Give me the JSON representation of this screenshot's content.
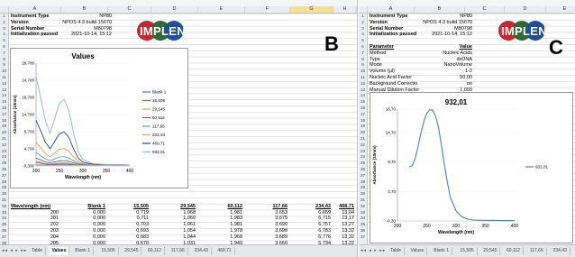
{
  "panel_b": {
    "columns": [
      "A",
      "B",
      "C",
      "D",
      "E",
      "F",
      "G",
      "H"
    ],
    "rows": [
      "1",
      "2",
      "3",
      "4",
      "5",
      "6",
      "7",
      "8",
      "9",
      "10",
      "11",
      "12",
      "13",
      "14",
      "15",
      "16",
      "17",
      "18",
      "19",
      "20",
      "21",
      "22",
      "23",
      "24",
      "25",
      "26",
      "27",
      "28",
      "29",
      "30",
      "31",
      "32",
      "33",
      "34",
      "35",
      "36",
      "37",
      "38",
      "39"
    ],
    "info": [
      {
        "label": "Instrument Type",
        "value": "NP80"
      },
      {
        "label": "Version",
        "value": "NPOS 4.3 build 15670"
      },
      {
        "label": "Serial Number",
        "value": "M80798"
      },
      {
        "label": "Initialization passed",
        "value": "2021-10-14, 15:12"
      }
    ],
    "logo": "IMPLEN",
    "panel_letter": "B",
    "table_headers": [
      "Wavelength (nm)",
      "Blank 1",
      "15,505",
      "29,545",
      "60,112",
      "117,66",
      "234,43",
      "468,71"
    ],
    "table_rows": [
      [
        "200",
        "0,000",
        "0,719",
        "1,068",
        "1,981",
        "3,653",
        "6,659",
        "13,04"
      ],
      [
        "201",
        "0,000",
        "0,711",
        "1,060",
        "1,983",
        "3,675",
        "6,715",
        "13,17"
      ],
      [
        "202",
        "0,000",
        "0,703",
        "1,061",
        "1,981",
        "3,690",
        "6,757",
        "13,27"
      ],
      [
        "203",
        "0,000",
        "0,693",
        "1,054",
        "1,978",
        "3,698",
        "6,783",
        "13,32"
      ],
      [
        "204",
        "0,000",
        "0,683",
        "1,044",
        "1,968",
        "3,689",
        "6,776",
        "13,32"
      ],
      [
        "205",
        "0,000",
        "0,670",
        "1,031",
        "1,949",
        "3,660",
        "6,734",
        "13,22"
      ]
    ],
    "tabs": [
      "Table",
      "Values",
      "Blank 1",
      "15,505",
      "29,545",
      "60,112",
      "117,66",
      "234,43",
      "468,71"
    ],
    "active_tab": "Values"
  },
  "panel_c": {
    "columns": [
      "A",
      "B",
      "C",
      "D",
      "E"
    ],
    "rows": [
      "1",
      "2",
      "3",
      "4",
      "5",
      "6",
      "7",
      "8",
      "9",
      "10",
      "11",
      "12",
      "13",
      "14",
      "15",
      "16",
      "17",
      "18",
      "19",
      "20",
      "21",
      "22",
      "23",
      "24",
      "25",
      "26",
      "27",
      "28",
      "29",
      "30",
      "31",
      "32",
      "33",
      "34",
      "35",
      "36",
      "37"
    ],
    "info": [
      {
        "label": "Instrument Type",
        "value": "NP80"
      },
      {
        "label": "Version",
        "value": "NPOS 4.3 build 15670"
      },
      {
        "label": "Serial Number",
        "value": "M80798"
      },
      {
        "label": "Initialization passed",
        "value": "2021-10-14, 15:12"
      }
    ],
    "param_header": {
      "label": "Parameter",
      "value": "Value"
    },
    "params": [
      {
        "label": "Method",
        "value": "Nucleic Acids"
      },
      {
        "label": "Type",
        "value": "dsDNA"
      },
      {
        "label": "Mode",
        "value": "NanoVolume"
      },
      {
        "label": "Volume (µl)",
        "value": "1-2"
      },
      {
        "label": "Nucleic Acid Factor",
        "value": "50,00"
      },
      {
        "label": "Background Correctio",
        "value": "on"
      },
      {
        "label": "Manual Dilution Factor",
        "value": "1,000"
      }
    ],
    "logo": "IMPLEN",
    "panel_letter": "C",
    "tabs": [
      "Table",
      "Values",
      "Blank 1",
      "15,505",
      "29,545",
      "60,112",
      "117,66",
      "234,43",
      "468,71",
      "932,01"
    ],
    "active_tab": "932,01"
  },
  "chart_data": [
    {
      "type": "line",
      "title": "Values",
      "xlabel": "Wavelength (nm)",
      "ylabel": "Absorbance (10mm)",
      "xlim": [
        200,
        400
      ],
      "ylim": [
        -0.3,
        29.7
      ],
      "xticks": [
        200,
        250,
        300,
        350,
        400
      ],
      "yticks": [
        "29,700",
        "24,700",
        "19,700",
        "14,700",
        "9,700",
        "4,700",
        "-0,300"
      ],
      "legend_position": "right",
      "x": [
        200,
        210,
        220,
        230,
        240,
        250,
        260,
        270,
        280,
        290,
        300,
        320,
        350,
        400
      ],
      "series": [
        {
          "name": "Blank 1",
          "color": "#4a77b4",
          "values": [
            0,
            0,
            0,
            0,
            0,
            0,
            0,
            0,
            0,
            0,
            0,
            0,
            0,
            0
          ]
        },
        {
          "name": "15,505",
          "color": "#c0504d",
          "values": [
            0.72,
            0.5,
            0.28,
            0.16,
            0.22,
            0.29,
            0.31,
            0.26,
            0.15,
            0.06,
            0.03,
            0.01,
            0,
            0
          ]
        },
        {
          "name": "29,545",
          "color": "#9bbb59",
          "values": [
            1.07,
            0.75,
            0.45,
            0.28,
            0.42,
            0.56,
            0.6,
            0.5,
            0.29,
            0.12,
            0.05,
            0.02,
            0.01,
            0
          ]
        },
        {
          "name": "60,112",
          "color": "#8064a2",
          "values": [
            1.98,
            1.45,
            0.9,
            0.6,
            0.88,
            1.15,
            1.22,
            1.02,
            0.6,
            0.25,
            0.1,
            0.03,
            0.01,
            0
          ]
        },
        {
          "name": "117,66",
          "color": "#4bacc6",
          "values": [
            3.65,
            2.7,
            1.75,
            1.2,
            1.75,
            2.3,
            2.42,
            2.02,
            1.2,
            0.5,
            0.2,
            0.06,
            0.02,
            0
          ]
        },
        {
          "name": "234,43",
          "color": "#f79646",
          "values": [
            6.66,
            5.0,
            3.3,
            2.35,
            3.45,
            4.55,
            4.8,
            4.0,
            2.35,
            0.98,
            0.4,
            0.12,
            0.03,
            0
          ]
        },
        {
          "name": "468,71",
          "color": "#2c4d75",
          "values": [
            13.04,
            9.9,
            6.6,
            4.7,
            6.9,
            9.1,
            9.6,
            8.0,
            4.7,
            1.95,
            0.8,
            0.24,
            0.06,
            0
          ]
        },
        {
          "name": "932,01",
          "color": "#95b3d7",
          "values": [
            25.8,
            19.5,
            12.9,
            9.2,
            13.6,
            18.0,
            19.1,
            15.9,
            9.3,
            3.8,
            1.5,
            0.45,
            0.12,
            0
          ]
        }
      ]
    },
    {
      "type": "line",
      "title": "932,01",
      "xlabel": "Wavelength (nm)",
      "ylabel": "Absorbance (10mm)",
      "xlim": [
        200,
        400
      ],
      "ylim": [
        -0.3,
        18.7
      ],
      "xticks": [
        200,
        250,
        300,
        350,
        400
      ],
      "yticks": [
        "18,70",
        "14,70",
        "9,70",
        "4,70",
        "-0,30"
      ],
      "legend_position": "right",
      "x": [
        220,
        225,
        230,
        235,
        240,
        245,
        250,
        255,
        260,
        265,
        270,
        275,
        280,
        285,
        290,
        300,
        310,
        320,
        330,
        350,
        400
      ],
      "series": [
        {
          "name": "932,01",
          "color": "#4a7ec2",
          "values": [
            8.9,
            9.1,
            10.2,
            12.3,
            14.6,
            16.6,
            18.0,
            18.6,
            18.5,
            17.5,
            15.6,
            12.6,
            9.3,
            6.3,
            3.8,
            1.4,
            0.4,
            0.0,
            -0.15,
            -0.2,
            -0.25
          ]
        }
      ]
    }
  ]
}
